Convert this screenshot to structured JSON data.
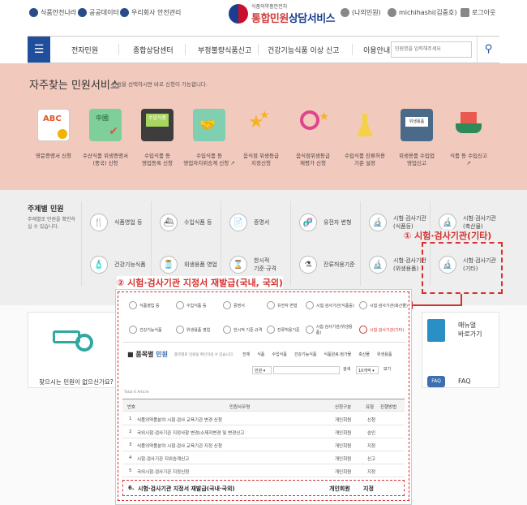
{
  "header": {
    "util_links": [
      "식품안전나라",
      "공공데이터",
      "우리회사 안전관리"
    ],
    "logo_small": "식품의약품안전처",
    "logo_main_a": "통합",
    "logo_main_b": "민원",
    "logo_main_c": "상담서비스",
    "right_links": [
      "(나의민원)",
      "michihashi(김중호)",
      "로그아웃"
    ]
  },
  "nav": {
    "menu_icon": "menu-icon",
    "items": [
      "전자민원",
      "종합상담센터",
      "부정불량식품신고",
      "건강기능식품 이상 신고",
      "이용안내"
    ],
    "search_placeholder": "민원명을 입력해주세요"
  },
  "favorites": {
    "title": "자주찾는 민원서비스",
    "subtitle": "민원을 선택하시면 바로 신청이 가능합니다.",
    "items": [
      {
        "label1": "영문증명서 신청",
        "label2": ""
      },
      {
        "label1": "수산식품 위생증명서",
        "label2": "(중국) 신청"
      },
      {
        "label1": "수입식품 등",
        "label2": "영업등록 신청"
      },
      {
        "label1": "수입식품 등",
        "label2": "영업자지위승계 신청"
      },
      {
        "label1": "음식점 위생등급",
        "label2": "지정신청"
      },
      {
        "label1": "음식점위생등급",
        "label2": "재평가 신청"
      },
      {
        "label1": "수입식품 잔류허용",
        "label2": "기준 설정"
      },
      {
        "label1": "위생용품 수입업",
        "label2": "영업신고"
      },
      {
        "label1": "식품 등 수입신고",
        "label2": ""
      }
    ]
  },
  "topic": {
    "title": "주제별 민원",
    "subtitle": "주제별로 민원을 확인하실 수 있습니다.",
    "row1": [
      {
        "label": "식품영업 등",
        "icon": "fork-knife-icon"
      },
      {
        "label": "수입식품 등",
        "icon": "ship-icon"
      },
      {
        "label": "증명서",
        "icon": "certificate-icon"
      },
      {
        "label": "유전자 변형",
        "icon": "dna-icon"
      },
      {
        "label": "시험·검사기관",
        "label2": "(식품등)",
        "icon": "microscope-icon"
      },
      {
        "label": "시험·검사기관",
        "label2": "(축산물)",
        "icon": "microscope-icon"
      }
    ],
    "row2": [
      {
        "label": "건강기능식품",
        "icon": "bottle-icon"
      },
      {
        "label": "위생용품 영업",
        "icon": "jar-icon"
      },
      {
        "label": "한시적",
        "label2": "기준·규격",
        "icon": "hourglass-icon"
      },
      {
        "label": "잔류허용기준",
        "icon": "flask-icon"
      },
      {
        "label": "시험·검사기관",
        "label2": "(위생용품)",
        "icon": "microscope-icon"
      },
      {
        "label": "시험·검사기관",
        "label2": "(기타)",
        "icon": "microscope-icon"
      }
    ]
  },
  "annotations": {
    "a1": "① 시험·검사기관(기타)",
    "a2": "② 시험·검사기관 지정서 재발급(국내, 국외)"
  },
  "lower": {
    "find_text": "찾으시는 민원이 없으신가요?",
    "manual": "매뉴얼",
    "manual2": "바로가기",
    "faq_badge": "FAQ",
    "faq_label": "FAQ"
  },
  "overlay": {
    "grid": [
      "식품영업 등",
      "수입식품 등",
      "증명서",
      "유전자 변형",
      "시험·검사기관(식품등)",
      "시험·검사기관(축산물)",
      "건강기능식품",
      "위생용품 영업",
      "한시적 기준·규격",
      "잔류허용기준",
      "시험·검사기관(위생용품)",
      "시험·검사기관(기타)"
    ],
    "section_title_a": "품목별",
    "section_title_b": "민원",
    "section_desc": "품목별로 민원을 확인하실 수 있습니다.",
    "tabs": [
      "전체",
      "식품",
      "수입식품",
      "건강기능식품",
      "식품원료·첨가물",
      "축산물",
      "위생용품"
    ],
    "filter_select": "민원",
    "search_btn": "검색",
    "per_page": "10개씩",
    "view_btn": "보기",
    "total": "Total 6 Article",
    "table_headers": [
      "번호",
      "민원사무명",
      "신청구분",
      "유형",
      "진행방법"
    ],
    "rows": [
      {
        "no": "1",
        "name": "식품의약품분야 시험·검사 교육기관 변경 신청",
        "type": "개인회원",
        "kind": "신청",
        "method": ""
      },
      {
        "no": "2",
        "name": "국외시험·검사기관 지정사항 변경(소재지변경 및 변경신고",
        "type": "개인회원",
        "kind": "승인",
        "method": ""
      },
      {
        "no": "3",
        "name": "식품의약품분야 시험·검사 교육기관 지정 신청",
        "type": "개인회원",
        "kind": "지정",
        "method": ""
      },
      {
        "no": "4",
        "name": "시험·검사기관 지위승계신고",
        "type": "개인회원",
        "kind": "신고",
        "method": ""
      },
      {
        "no": "5",
        "name": "국외시험·검사기관 지정신청",
        "type": "개인회원",
        "kind": "지정",
        "method": ""
      },
      {
        "no": "6.",
        "name": "시험·검사기관 지정서 재발급(국내·국외)",
        "type": "개인회원",
        "kind": "지정",
        "method": ""
      }
    ]
  }
}
